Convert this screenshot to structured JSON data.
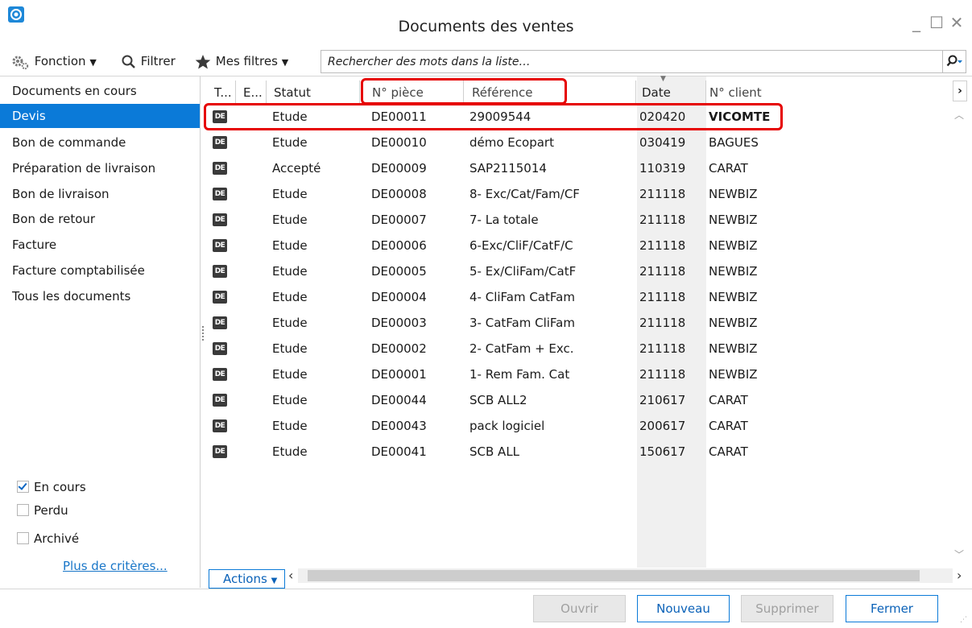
{
  "window": {
    "title": "Documents des ventes",
    "minimize": "_",
    "maximize": "☐",
    "close": "✕"
  },
  "toolbar": {
    "fonction_label": "Fonction",
    "filtrer_label": "Filtrer",
    "mes_filtres_label": "Mes filtres"
  },
  "search": {
    "placeholder": "Rechercher des mots dans la liste…"
  },
  "sidebar": {
    "items": [
      {
        "label": "Documents en cours",
        "active": false
      },
      {
        "label": "Devis",
        "active": true
      },
      {
        "label": "Bon de commande",
        "active": false
      },
      {
        "label": "Préparation de livraison",
        "active": false
      },
      {
        "label": "Bon de livraison",
        "active": false
      },
      {
        "label": "Bon de retour",
        "active": false
      },
      {
        "label": "Facture",
        "active": false
      },
      {
        "label": "Facture comptabilisée",
        "active": false
      },
      {
        "label": "Tous les documents",
        "active": false
      }
    ],
    "filters": [
      {
        "label": "En cours",
        "checked": true
      },
      {
        "label": "Perdu",
        "checked": false
      },
      {
        "label": "Archivé",
        "checked": false
      }
    ],
    "more_criteria": "Plus de critères..."
  },
  "table": {
    "columns": {
      "type": "T...",
      "etat": "E...",
      "statut": "Statut",
      "piece": "N° pièce",
      "reference": "Référence",
      "date": "Date",
      "client": "N° client"
    },
    "type_badge": "DE",
    "rows": [
      {
        "statut": "Etude",
        "piece": "DE00011",
        "reference": "29009544",
        "date": "020420",
        "client": "VICOMTE"
      },
      {
        "statut": "Etude",
        "piece": "DE00010",
        "reference": "démo Ecopart",
        "date": "030419",
        "client": "BAGUES"
      },
      {
        "statut": "Accepté",
        "piece": "DE00009",
        "reference": "SAP2115014",
        "date": "110319",
        "client": "CARAT"
      },
      {
        "statut": "Etude",
        "piece": "DE00008",
        "reference": "8- Exc/Cat/Fam/CF",
        "date": "211118",
        "client": "NEWBIZ"
      },
      {
        "statut": "Etude",
        "piece": "DE00007",
        "reference": "7- La totale",
        "date": "211118",
        "client": "NEWBIZ"
      },
      {
        "statut": "Etude",
        "piece": "DE00006",
        "reference": "6-Exc/CliF/CatF/C",
        "date": "211118",
        "client": "NEWBIZ"
      },
      {
        "statut": "Etude",
        "piece": "DE00005",
        "reference": "5- Ex/CliFam/CatF",
        "date": "211118",
        "client": "NEWBIZ"
      },
      {
        "statut": "Etude",
        "piece": "DE00004",
        "reference": "4- CliFam CatFam",
        "date": "211118",
        "client": "NEWBIZ"
      },
      {
        "statut": "Etude",
        "piece": "DE00003",
        "reference": "3- CatFam CliFam",
        "date": "211118",
        "client": "NEWBIZ"
      },
      {
        "statut": "Etude",
        "piece": "DE00002",
        "reference": "2- CatFam + Exc.",
        "date": "211118",
        "client": "NEWBIZ"
      },
      {
        "statut": "Etude",
        "piece": "DE00001",
        "reference": "1- Rem Fam. Cat",
        "date": "211118",
        "client": "NEWBIZ"
      },
      {
        "statut": "Etude",
        "piece": "DE00044",
        "reference": "SCB ALL2",
        "date": "210617",
        "client": "CARAT"
      },
      {
        "statut": "Etude",
        "piece": "DE00043",
        "reference": "pack logiciel",
        "date": "200617",
        "client": "CARAT"
      },
      {
        "statut": "Etude",
        "piece": "DE00041",
        "reference": "SCB ALL",
        "date": "150617",
        "client": "CARAT"
      }
    ]
  },
  "actions_label": "Actions",
  "buttons": {
    "ouvrir": "Ouvrir",
    "nouveau": "Nouveau",
    "supprimer": "Supprimer",
    "fermer": "Fermer"
  },
  "colors": {
    "accent": "#0b7ad8",
    "highlight": "#e60000"
  }
}
